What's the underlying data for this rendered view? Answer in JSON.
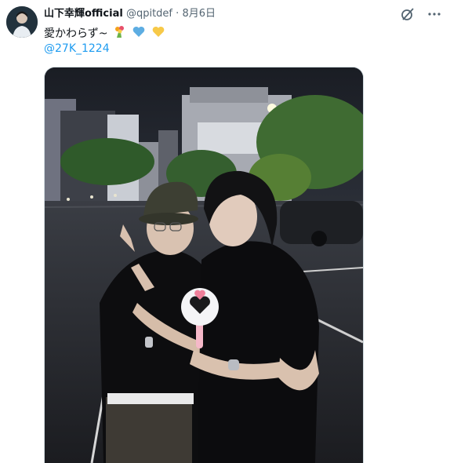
{
  "user": {
    "display_name": "山下幸輝official",
    "handle": "@qpitdef",
    "separator": "·",
    "date": "8月6日"
  },
  "tweet": {
    "text": "愛かわらず~",
    "emoji": [
      "bouquet",
      "blue-heart",
      "yellow-heart"
    ],
    "mention": "@27K_1224"
  },
  "icons": {
    "top_right": [
      "grok-icon",
      "more-icon"
    ]
  },
  "colors": {
    "link": "#1d9bf0",
    "muted": "#536471",
    "text": "#0f1419"
  }
}
